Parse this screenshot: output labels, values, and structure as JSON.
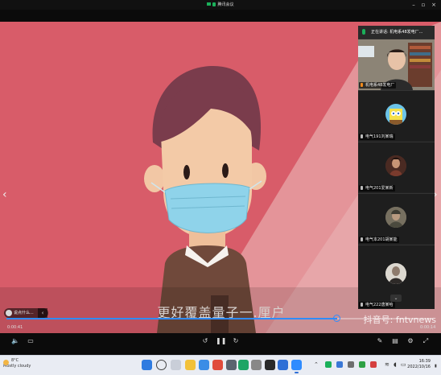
{
  "window": {
    "title": "腾讯会议",
    "controls": [
      "minimize-icon",
      "restore-icon",
      "close-icon"
    ]
  },
  "speaking": {
    "label": "正在讲话: 机电系48发电厂..."
  },
  "participants": [
    {
      "name": "机电系48发电厂",
      "icon": "person-video"
    },
    {
      "name": "电气191刘某瑞",
      "icon": "spongebob-avatar"
    },
    {
      "name": "电气201爱某新",
      "icon": "warrior-avatar"
    },
    {
      "name": "电气本201胡某能",
      "icon": "soldier-avatar"
    },
    {
      "name": "电气222唐某哈",
      "icon": "character-avatar"
    }
  ],
  "video": {
    "subtitle": "更好覆盖量子一.厘户",
    "watermark": "抖音号: fntvnews",
    "elapsed": "0:00:41",
    "duration": "0:00:14",
    "progress": 0.775,
    "chat_chip": "说点什么..."
  },
  "colors": {
    "bg_red": "#d85c69",
    "bg_pink": "#e69a9f",
    "accent_blue": "#2f8cff",
    "mask": "#8fd3ea"
  },
  "taskbar": {
    "weather_temp": "8°C",
    "weather_text": "Mostly cloudy",
    "time": "16:39",
    "date": "2022/10/16"
  }
}
